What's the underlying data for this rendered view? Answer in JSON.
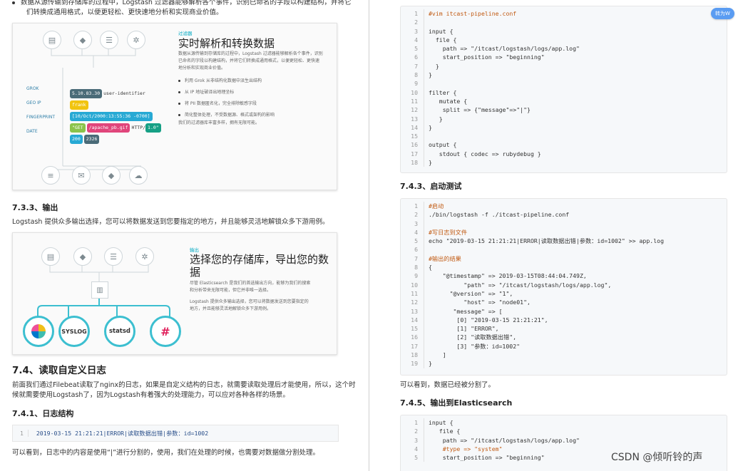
{
  "left": {
    "top_bullet_line1": "数据从源传输到存储库的过程中，Logstash 过滤器能够解析各个事件，识别已命名的字段以构建结构，并将它",
    "top_bullet_line2": "们转换成通用格式，以便更轻松、更快速地分析和实现商业价值。",
    "figure1": {
      "tag": "过滤器",
      "title": "实时解析和转换数据",
      "desc": [
        "数据从源传输到存储库的过程中，Logstash 过滤器能够解析各个事件，识别",
        "已命名的字段以构建结构，并将它们转换成通用格式，以便更轻松、更快速",
        "地分析和实现商业价值。"
      ],
      "bullets": [
        "利用 Grok 从非结构化数据中派生出结构",
        "从 IP 地址破译出地理坐标",
        "将 PII 数据匿名化，完全排除敏感字段",
        "简化整体处理，不受数据源、格式或架构的影响"
      ],
      "footer": "我们的过滤器库丰富多样，拥有无限可能。",
      "labels": [
        "GROK",
        "GEO IP",
        "FINGERPRINT",
        "DATE"
      ],
      "pills": {
        "ip": "5.10.83.30",
        "user": "user-identifier",
        "frank": "frank",
        "date": "[10/Oct/2000:13:55:36 -0700]",
        "get": "\"GET",
        "path": "/apache_pb.gif",
        "http": "HTTP/",
        "version": "1.0\"",
        "status": "200",
        "size": "2326"
      }
    },
    "sec733": "7.3.3、输出",
    "sec733_text": "Logstash 提供众多输出选择，您可以将数据发送到您要指定的地方，并且能够灵活地解锁众多下游用例。",
    "figure2": {
      "tag": "输出",
      "title_line1": "选择您的存储库，导出您的数",
      "title_line2": "据",
      "desc1": [
        "尽管 Elasticsearch 是我们的首选输出方向，能够为我们的搜索",
        "和分析带来无限可能，但它并非唯一选择。"
      ],
      "desc2": [
        "Logstash 提供众多输出选择，您可以将数据发送到您要指定的",
        "地方，并且能够灵活地解锁众多下游用例。"
      ],
      "outputs": [
        "SYSLOG",
        "statsd"
      ]
    },
    "sec74": "7.4、读取自定义日志",
    "sec74_text1": "前面我们通过Filebeat读取了nginx的日志，如果是自定义结构的日志，就需要读取处理后才能使用，所以，这个时",
    "sec74_text2": "候就需要使用Logstash了，因为Logstash有着强大的处理能力，可以应对各种各样的场景。",
    "sec741": "7.4.1、日志结构",
    "log_line": "2019-03-15 21:21:21|ERROR|读取数据出错|参数：id=1002",
    "bottom_text": "可以看到，日志中的内容是使用“|”进行分割的，使用，我们在处理的时候，也需要对数据做分割处理。"
  },
  "right": {
    "code1": [
      {
        "n": "1",
        "t": "#vim itcast-pipeline.conf",
        "c": "cm"
      },
      {
        "n": "2",
        "t": "",
        "c": "ct"
      },
      {
        "n": "3",
        "t": "input {",
        "c": "ct"
      },
      {
        "n": "4",
        "t": "  file {",
        "c": "ct"
      },
      {
        "n": "5",
        "t": "    path => \"/itcast/logstash/logs/app.log\"",
        "c": "ct"
      },
      {
        "n": "6",
        "t": "    start_position => \"beginning\"",
        "c": "ct"
      },
      {
        "n": "7",
        "t": "  }",
        "c": "ct"
      },
      {
        "n": "8",
        "t": "}",
        "c": "ct"
      },
      {
        "n": "9",
        "t": "",
        "c": "ct"
      },
      {
        "n": "10",
        "t": "filter {",
        "c": "ct"
      },
      {
        "n": "11",
        "t": "   mutate {",
        "c": "ct"
      },
      {
        "n": "12",
        "t": "    split => {\"message\"=>\"|\"}",
        "c": "ct"
      },
      {
        "n": "13",
        "t": "   }",
        "c": "ct"
      },
      {
        "n": "14",
        "t": "}",
        "c": "ct"
      },
      {
        "n": "15",
        "t": "",
        "c": "ct"
      },
      {
        "n": "16",
        "t": "output {",
        "c": "ct"
      },
      {
        "n": "17",
        "t": "   stdout { codec => rubydebug }",
        "c": "ct"
      },
      {
        "n": "18",
        "t": "}",
        "c": "ct"
      }
    ],
    "sec743": "7.4.3、启动测试",
    "code2": [
      {
        "n": "1",
        "t": "#启动",
        "c": "cm"
      },
      {
        "n": "2",
        "t": "./bin/logstash -f ./itcast-pipeline.conf",
        "c": "ct"
      },
      {
        "n": "3",
        "t": "",
        "c": "ct"
      },
      {
        "n": "4",
        "t": "#写日志到文件",
        "c": "cm"
      },
      {
        "n": "5",
        "t": "echo \"2019-03-15 21:21:21|ERROR|读取数据出错|参数：id=1002\" >> app.log",
        "c": "ct"
      },
      {
        "n": "6",
        "t": "",
        "c": "ct"
      },
      {
        "n": "7",
        "t": "#输出的结果",
        "c": "cm"
      },
      {
        "n": "8",
        "t": "{",
        "c": "ct"
      },
      {
        "n": "9",
        "t": "    \"@timestamp\" => 2019-03-15T08:44:04.749Z,",
        "c": "ct"
      },
      {
        "n": "10",
        "t": "          \"path\" => \"/itcast/logstash/logs/app.log\",",
        "c": "ct"
      },
      {
        "n": "11",
        "t": "      \"@version\" => \"1\",",
        "c": "ct"
      },
      {
        "n": "12",
        "t": "          \"host\" => \"node01\",",
        "c": "ct"
      },
      {
        "n": "13",
        "t": "       \"message\" => [",
        "c": "ct"
      },
      {
        "n": "14",
        "t": "        [0] \"2019-03-15 21:21:21\",",
        "c": "ct"
      },
      {
        "n": "15",
        "t": "        [1] \"ERROR\",",
        "c": "ct"
      },
      {
        "n": "16",
        "t": "        [2] \"读取数据出错\",",
        "c": "ct"
      },
      {
        "n": "17",
        "t": "        [3] \"参数：id=1002\"",
        "c": "ct"
      },
      {
        "n": "18",
        "t": "    ]",
        "c": "ct"
      },
      {
        "n": "19",
        "t": "}",
        "c": "ct"
      }
    ],
    "after_text": "可以看到，数据已经被分割了。",
    "sec745": "7.4.5、输出到Elasticsearch",
    "code3": [
      {
        "n": "1",
        "t": "input {",
        "c": "ct"
      },
      {
        "n": "2",
        "t": "   file {",
        "c": "ct"
      },
      {
        "n": "3",
        "t": "    path => \"/itcast/logstash/logs/app.log\"",
        "c": "ct"
      },
      {
        "n": "4",
        "t": "    #type => \"system\"",
        "c": "cm"
      },
      {
        "n": "5",
        "t": "    start_position => \"beginning\"",
        "c": "ct"
      }
    ]
  },
  "badge": "转为W",
  "watermark": "CSDN @倾听铃的声"
}
